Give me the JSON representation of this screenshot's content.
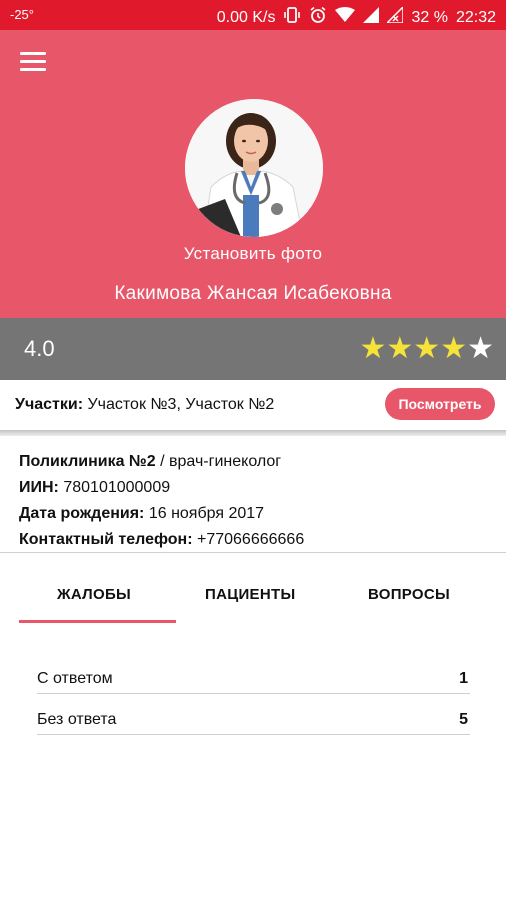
{
  "status_bar": {
    "temperature": "-25°",
    "net_speed": "0.00 K/s",
    "battery": "32 %",
    "time": "22:32",
    "icons": [
      "vibrate-icon",
      "alarm-icon",
      "wifi-icon",
      "signal-icon",
      "no-sim-icon"
    ]
  },
  "header": {
    "set_photo_label": "Установить фото",
    "doctor_name": "Какимова Жансая Исабековна",
    "background_color": "#e8566a"
  },
  "rating": {
    "value": "4.0",
    "stars_filled": 4,
    "stars_total": 5,
    "star_color": "#f5e33a"
  },
  "areas": {
    "label": "Участки:",
    "value": "Участок №3, Участок №2",
    "button_label": "Посмотреть"
  },
  "info": {
    "clinic": "Поликлиника №2",
    "specialty": "врач-гинеколог",
    "iin_label": "ИИН:",
    "iin_value": "780101000009",
    "dob_label": "Дата рождения:",
    "dob_value": "16 ноября 2017",
    "phone_label": "Контактный телефон:",
    "phone_value": "+77066666666"
  },
  "tabs": [
    {
      "label": "ЖАЛОБЫ",
      "active": true
    },
    {
      "label": "ПАЦИЕНТЫ",
      "active": false
    },
    {
      "label": "ВОПРОСЫ",
      "active": false
    }
  ],
  "complaints": [
    {
      "label": "С ответом",
      "count": "1"
    },
    {
      "label": "Без ответа",
      "count": "5"
    }
  ]
}
